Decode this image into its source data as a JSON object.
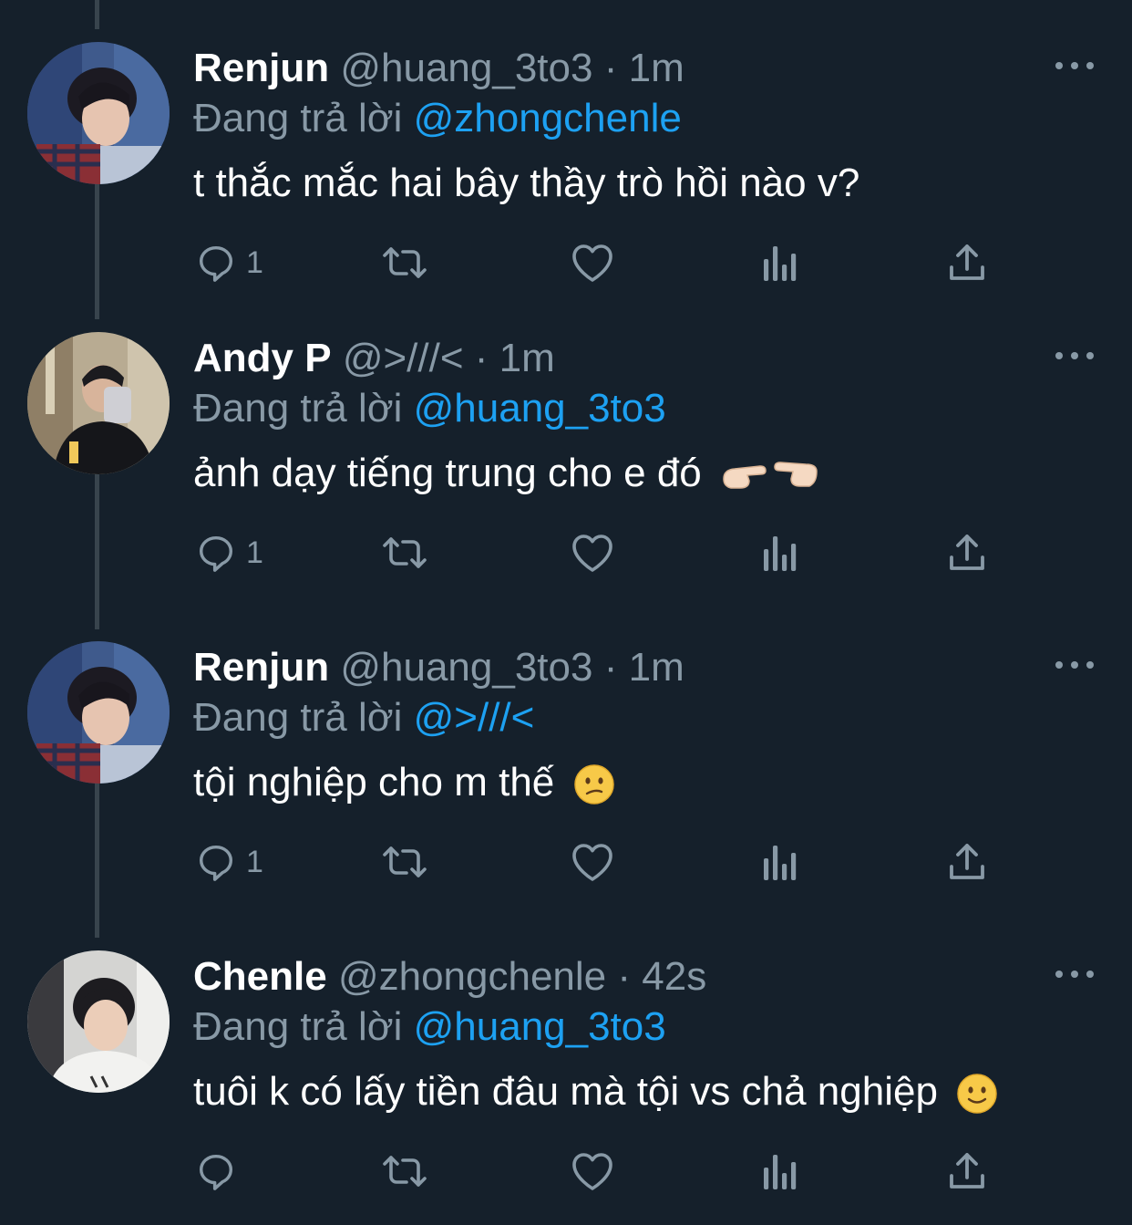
{
  "tweets": [
    {
      "name": "Renjun",
      "handle": "@huang_3to3",
      "time": "1m",
      "reply_prefix": "Đang trả lời",
      "reply_to": "@zhongchenle",
      "text": "t thắc mắc hai bây thầy trò hồi nào v?",
      "reply_count": "1",
      "avatar": "avatar-renjun"
    },
    {
      "name": "Andy P",
      "handle": "@>///<",
      "time": "1m",
      "reply_prefix": "Đang trả lời",
      "reply_to": "@huang_3to3",
      "text": "ảnh dạy tiếng trung cho e đó",
      "text_emoji": "pointing-hands-emoji",
      "reply_count": "1",
      "avatar": "avatar-andy"
    },
    {
      "name": "Renjun",
      "handle": "@huang_3to3",
      "time": "1m",
      "reply_prefix": "Đang trả lời",
      "reply_to": "@>///<",
      "text": "tội nghiệp cho m thế",
      "text_emoji": "confused-face-emoji",
      "reply_count": "1",
      "avatar": "avatar-renjun"
    },
    {
      "name": "Chenle",
      "handle": "@zhongchenle",
      "time": "42s",
      "reply_prefix": "Đang trả lời",
      "reply_to": "@huang_3to3",
      "text": "tuôi k có lấy tiền đâu mà tội vs chả nghiệp",
      "text_emoji": "slightly-smiling-face-emoji",
      "reply_count": "",
      "avatar": "avatar-chenle"
    }
  ],
  "separator": "·",
  "colors": {
    "background": "#15202b",
    "name": "#ffffff",
    "secondary": "#8899a6",
    "mention": "#1da1f2",
    "thread_line": "#38444d"
  },
  "icons": [
    "reply-icon",
    "retweet-icon",
    "like-icon",
    "analytics-icon",
    "share-icon",
    "more-icon"
  ]
}
